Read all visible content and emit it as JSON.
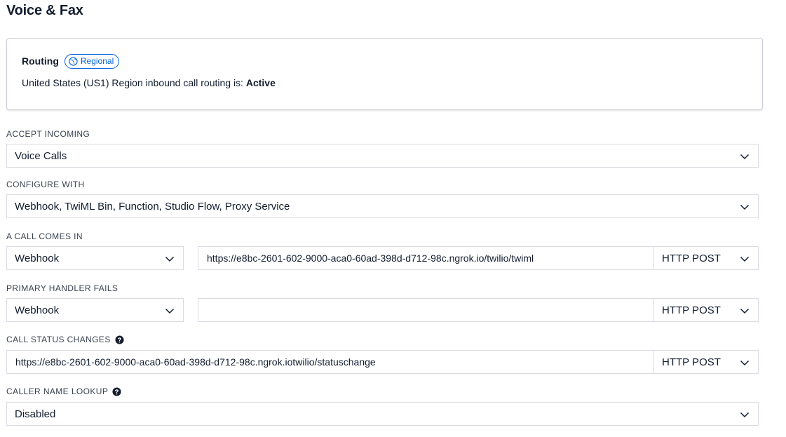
{
  "page": {
    "title": "Voice & Fax"
  },
  "routing": {
    "label": "Routing",
    "badge": "Regional",
    "status_prefix": "United States (US1) Region inbound call routing is: ",
    "status_value": "Active"
  },
  "accept_incoming": {
    "label": "ACCEPT INCOMING",
    "value": "Voice Calls"
  },
  "configure_with": {
    "label": "CONFIGURE WITH",
    "value": "Webhook, TwiML Bin, Function, Studio Flow, Proxy Service"
  },
  "call_comes_in": {
    "label": "A CALL COMES IN",
    "type": "Webhook",
    "url": "https://e8bc-2601-602-9000-aca0-60ad-398d-d712-98c.ngrok.io/twilio/twiml",
    "method": "HTTP POST"
  },
  "primary_handler_fails": {
    "label": "PRIMARY HANDLER FAILS",
    "type": "Webhook",
    "url": "",
    "method": "HTTP POST"
  },
  "call_status_changes": {
    "label": "CALL STATUS CHANGES",
    "url": "https://e8bc-2601-602-9000-aca0-60ad-398d-d712-98c.ngrok.iotwilio/statuschange",
    "method": "HTTP POST"
  },
  "caller_name_lookup": {
    "label": "CALLER NAME LOOKUP",
    "value": "Disabled"
  },
  "icons": {
    "badge": "globe-icon",
    "help": "question-circle-icon",
    "dropdown": "chevron-down-icon"
  },
  "colors": {
    "text": "#121c2d",
    "label": "#39414e",
    "accent": "#0263e0",
    "border": "#d9dce3"
  }
}
